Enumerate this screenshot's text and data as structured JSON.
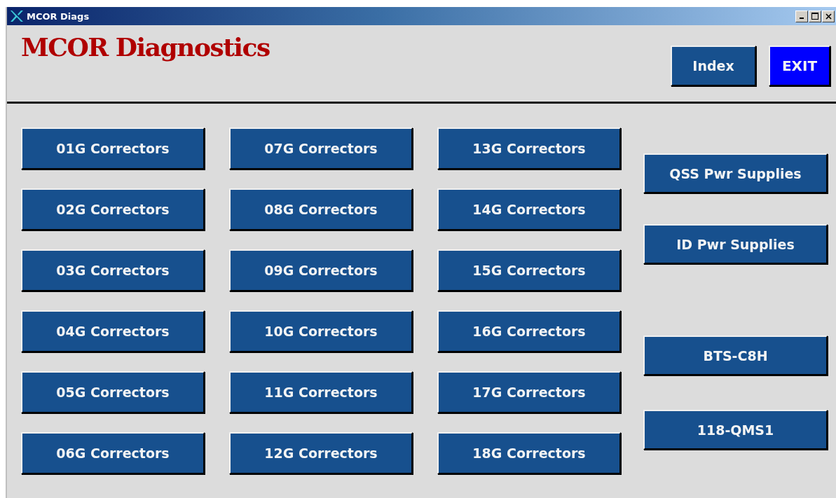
{
  "window": {
    "title": "MCOR Diags"
  },
  "heading": "MCOR Diagnostics",
  "header_buttons": [
    {
      "label": "Index",
      "kind": "normal"
    },
    {
      "label": "EXIT",
      "kind": "exit"
    }
  ],
  "corrector_columns": [
    [
      "01G Correctors",
      "02G Correctors",
      "03G Correctors",
      "04G Correctors",
      "05G Correctors",
      "06G Correctors"
    ],
    [
      "07G Correctors",
      "08G Correctors",
      "09G Correctors",
      "10G Correctors",
      "11G Correctors",
      "12G Correctors"
    ],
    [
      "13G Correctors",
      "14G Correctors",
      "15G Correctors",
      "16G Correctors",
      "17G Correctors",
      "18G Correctors"
    ]
  ],
  "side_buttons": [
    "QSS Pwr Supplies",
    "ID Pwr Supplies",
    "BTS-C8H",
    "118-QMS1"
  ]
}
